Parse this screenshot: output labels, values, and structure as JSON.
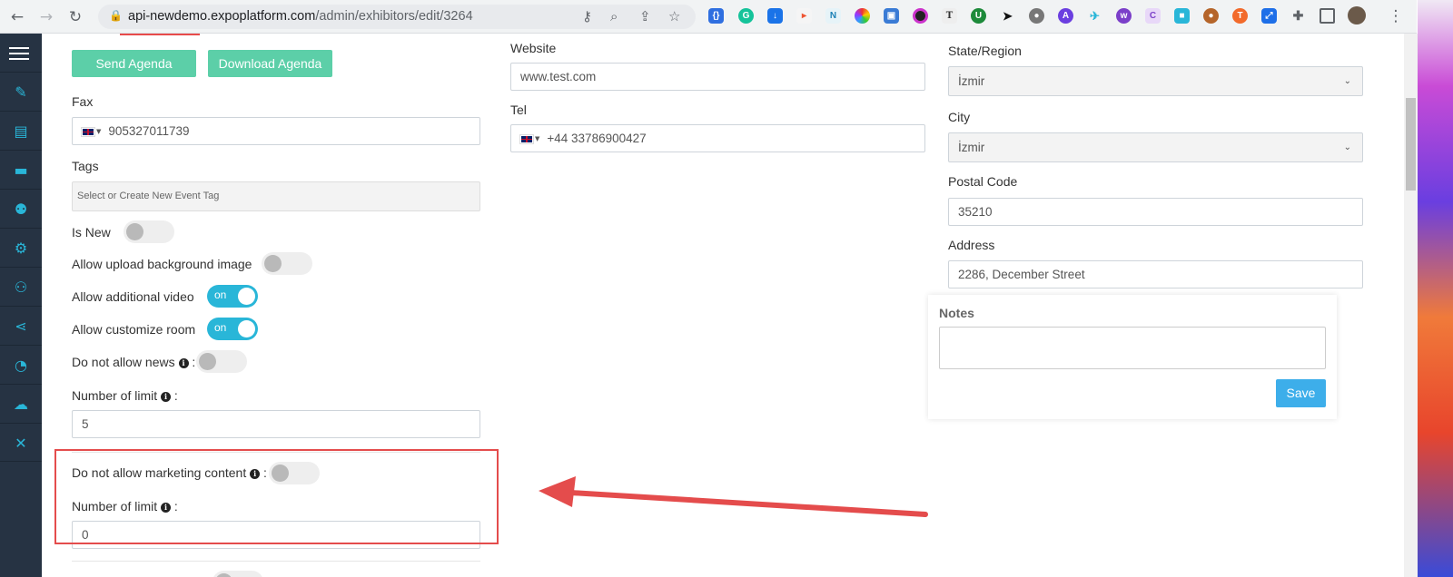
{
  "browser": {
    "url_host": "api-newdemo.expoplatform.com",
    "url_path": "/admin/exhibitors/edit/3264"
  },
  "left_col": {
    "send_agenda": "Send Agenda",
    "download_agenda": "Download Agenda",
    "fax_label": "Fax",
    "fax_value": "905327011739",
    "tags_label": "Tags",
    "tags_placeholder": "Select or Create New Event Tag",
    "is_new_label": "Is New",
    "allow_upload_bg_label": "Allow upload background image",
    "allow_additional_video_label": "Allow additional video",
    "allow_customize_room_label": "Allow customize room",
    "toggle_on_text": "on",
    "do_not_allow_news_label": "Do not allow news",
    "colon": ":",
    "number_of_limit_label": "Number of limit",
    "news_limit_value": "5",
    "do_not_allow_marketing_label": "Do not allow marketing content",
    "marketing_limit_value": "0"
  },
  "middle_col": {
    "website_label": "Website",
    "website_value": "www.test.com",
    "tel_label": "Tel",
    "tel_value": "+44 33786900427"
  },
  "right_col": {
    "state_label": "State/Region",
    "state_value": "İzmir",
    "city_label": "City",
    "city_value": "İzmir",
    "postal_label": "Postal Code",
    "postal_value": "35210",
    "address_label": "Address",
    "address_value": "2286, December Street",
    "notes_title": "Notes",
    "save_label": "Save"
  },
  "colors": {
    "sidebar": "#263343",
    "sidebar_icon": "#29b6d8",
    "green_button": "#5ccfa8",
    "toggle_on": "#29b6d8",
    "save_button": "#3daeea",
    "annotation_red": "#e44c4c"
  },
  "sidebar_icons": [
    "pencil-icon",
    "briefcase-icon",
    "bed-icon",
    "users-icon",
    "gear-icon",
    "sitemap-icon",
    "share-icon",
    "chart-pie-icon",
    "cloud-upload-icon",
    "wrench-icon"
  ]
}
